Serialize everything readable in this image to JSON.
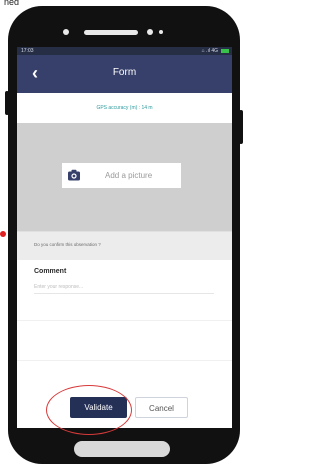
{
  "caption": "ned",
  "status_bar": {
    "time": "17:03",
    "icons": "⌂ .ıl 4G"
  },
  "app_bar": {
    "back_icon": "chevron-left-icon",
    "title": "Form"
  },
  "gps": {
    "text": "GPS accuracy (m) : 14 m"
  },
  "picture": {
    "icon": "camera-icon",
    "label": "Add a picture"
  },
  "confirm": {
    "question": "Do you confirm this observation ?"
  },
  "comment": {
    "label": "Comment",
    "placeholder": "Enter your response..."
  },
  "actions": {
    "validate": "Validate",
    "cancel": "Cancel"
  },
  "colors": {
    "app_bar": "#36406a",
    "status_bar": "#262e46",
    "validate": "#253057",
    "highlight": "#d83a3a",
    "battery": "#38c24b",
    "gps_text": "#2f9c9f"
  }
}
